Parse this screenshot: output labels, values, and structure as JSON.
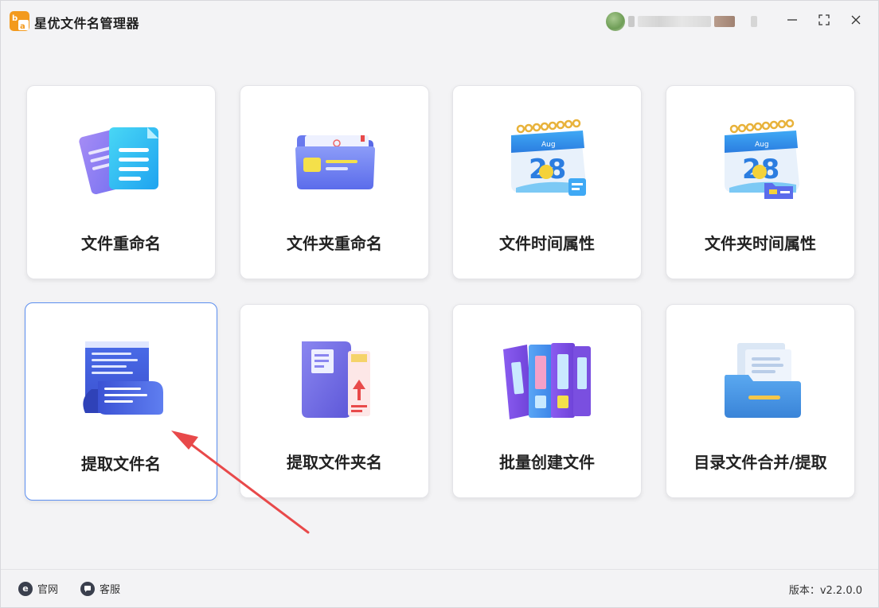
{
  "app": {
    "title": "星优文件名管理器",
    "logo_text": "b a"
  },
  "window_controls": {
    "pin_icon": "pin-icon",
    "minimize_icon": "minimize-icon",
    "maximize_icon": "maximize-icon",
    "close_icon": "close-icon"
  },
  "cards": [
    {
      "label": "文件重命名",
      "icon": "document-files-icon"
    },
    {
      "label": "文件夹重命名",
      "icon": "folder-icon"
    },
    {
      "label": "文件时间属性",
      "icon": "calendar-icon"
    },
    {
      "label": "文件夹时间属性",
      "icon": "calendar-folder-icon"
    },
    {
      "label": "提取文件名",
      "icon": "scroll-document-icon",
      "selected": true
    },
    {
      "label": "提取文件夹名",
      "icon": "book-folder-icon"
    },
    {
      "label": "批量创建文件",
      "icon": "binders-icon"
    },
    {
      "label": "目录文件合并/提取",
      "icon": "file-tray-icon"
    }
  ],
  "calendar": {
    "month": "Aug",
    "day": "28"
  },
  "footer": {
    "website_label": "官网",
    "support_label": "客服",
    "version_text": "版本：v2.2.0.0"
  },
  "colors": {
    "accent": "#5b8ef0",
    "arrow": "#e8494a",
    "background": "#f3f3f5"
  }
}
